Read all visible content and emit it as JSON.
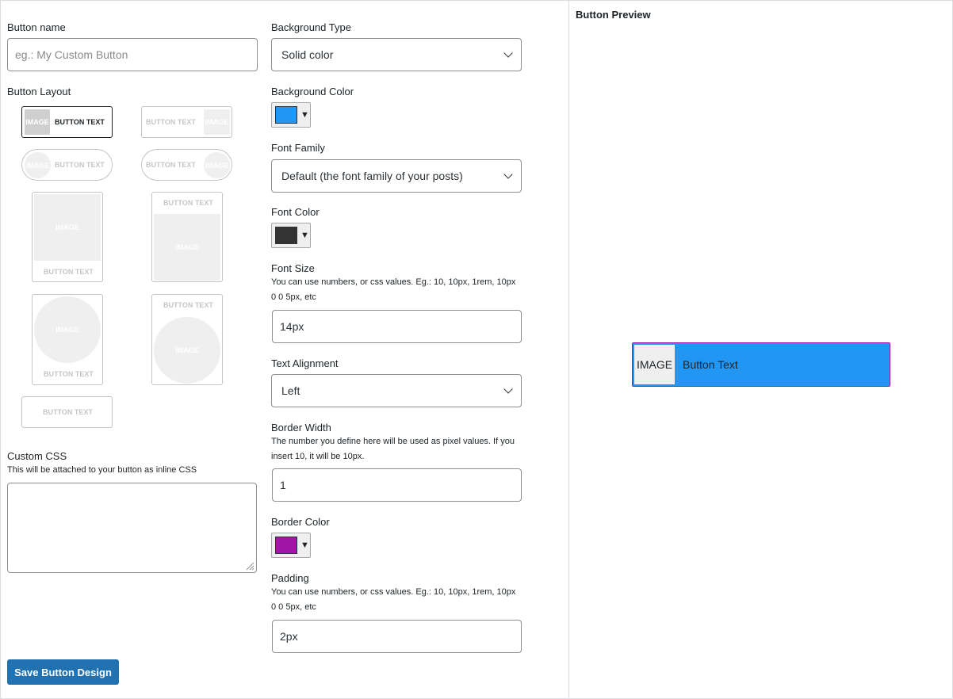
{
  "left": {
    "button_name_label": "Button name",
    "button_name_placeholder": "eg.: My Custom Button",
    "button_layout_label": "Button Layout",
    "layouts": {
      "image_text": {
        "image": "IMAGE",
        "text": "BUTTON TEXT"
      },
      "text_image": {
        "image": "IMAGE",
        "text": "BUTTON TEXT"
      },
      "pill_image_text": {
        "image": "IMAGE",
        "text": "BUTTON TEXT"
      },
      "pill_text_image": {
        "image": "IMAGE",
        "text": "BUTTON TEXT"
      },
      "image_top_text_bottom": {
        "image": "IMAGE",
        "text": "BUTTON TEXT"
      },
      "text_top_image_bottom": {
        "image": "IMAGE",
        "text": "BUTTON TEXT"
      },
      "circle_image_text_bottom": {
        "image": "IMAGE",
        "text": "BUTTON TEXT"
      },
      "text_top_circle_image": {
        "image": "IMAGE",
        "text": "BUTTON TEXT"
      },
      "text_only": {
        "text": "BUTTON TEXT"
      }
    },
    "selected_layout": "image_text",
    "custom_css_label": "Custom CSS",
    "custom_css_desc": "This will be attached to your button as inline CSS",
    "custom_css_value": "",
    "save_label": "Save Button Design"
  },
  "middle": {
    "background_type_label": "Background Type",
    "background_type_value": "Solid color",
    "background_color_label": "Background Color",
    "background_color": "#2196f3",
    "font_family_label": "Font Family",
    "font_family_value": "Default (the font family of your posts)",
    "font_color_label": "Font Color",
    "font_color": "#333333",
    "font_size_label": "Font Size",
    "font_size_desc": "You can use numbers, or css values. Eg.: 10, 10px, 1rem, 10px 0 0 5px, etc",
    "font_size_value": "14px",
    "text_alignment_label": "Text Alignment",
    "text_alignment_value": "Left",
    "border_width_label": "Border Width",
    "border_width_desc": "The number you define here will be used as pixel values. If you insert 10, it will be 10px.",
    "border_width_value": "1",
    "border_color_label": "Border Color",
    "border_color": "#a016a6",
    "padding_label": "Padding",
    "padding_desc": "You can use numbers, or css values. Eg.: 10, 10px, 1rem, 10px 0 0 5px, etc",
    "padding_value": "2px"
  },
  "preview": {
    "heading": "Button Preview",
    "image_label": "IMAGE",
    "button_text": "Button Text"
  }
}
